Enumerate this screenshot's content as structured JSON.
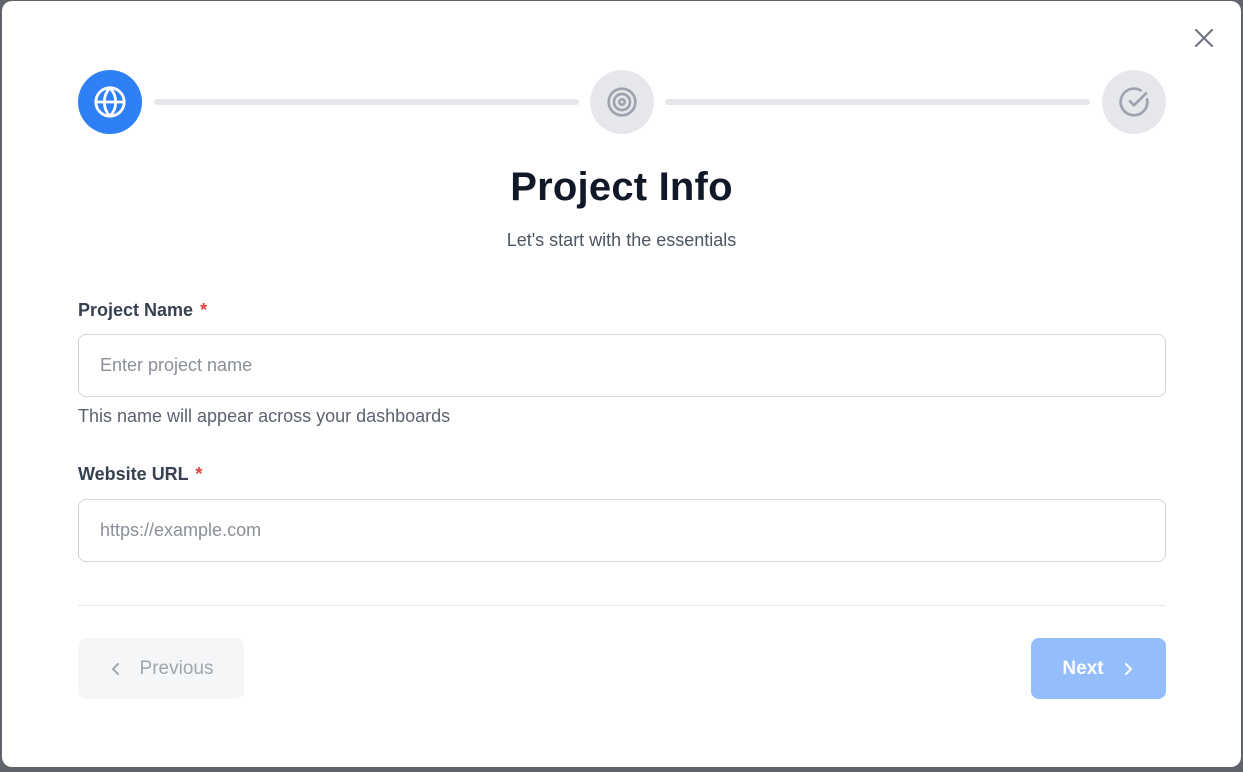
{
  "dialog": {
    "close_icon": "x-close-icon",
    "title": "Project Info",
    "subtitle": "Let's start with the essentials"
  },
  "stepper": {
    "steps": [
      {
        "icon": "globe-icon",
        "state": "active"
      },
      {
        "icon": "target-icon",
        "state": "inactive"
      },
      {
        "icon": "check-circle-icon",
        "state": "inactive"
      }
    ],
    "colors": {
      "active": "#2f7ff5",
      "inactive": "#e6e7eb"
    }
  },
  "form": {
    "project_name": {
      "label": "Project Name",
      "required_mark": "*",
      "value": "",
      "placeholder": "Enter project name",
      "help": "This name will appear across your dashboards"
    },
    "website_url": {
      "label": "Website URL",
      "required_mark": "*",
      "value": "",
      "placeholder": "https://example.com"
    }
  },
  "footer": {
    "previous_label": "Previous",
    "next_label": "Next"
  }
}
